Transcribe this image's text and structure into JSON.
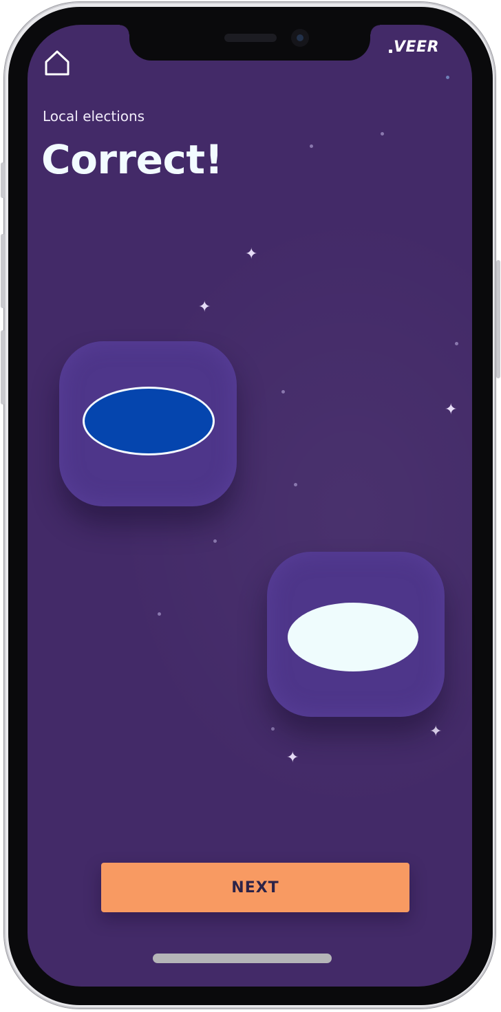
{
  "header": {
    "home_icon": "home-icon",
    "logo_text": "VEER"
  },
  "content": {
    "subtitle": "Local elections",
    "title": "Correct!"
  },
  "options": [
    {
      "shape": "oval",
      "fill_color": "#0545ae",
      "outline_color": "#f4fbff",
      "selected": true
    },
    {
      "shape": "oval",
      "fill_color": "#effcfd",
      "selected": false
    }
  ],
  "actions": {
    "next_label": "NEXT"
  },
  "colors": {
    "background": "#432a68",
    "card": "#4e368a",
    "accent_button": "#f89a62",
    "button_text": "#2c2348"
  }
}
